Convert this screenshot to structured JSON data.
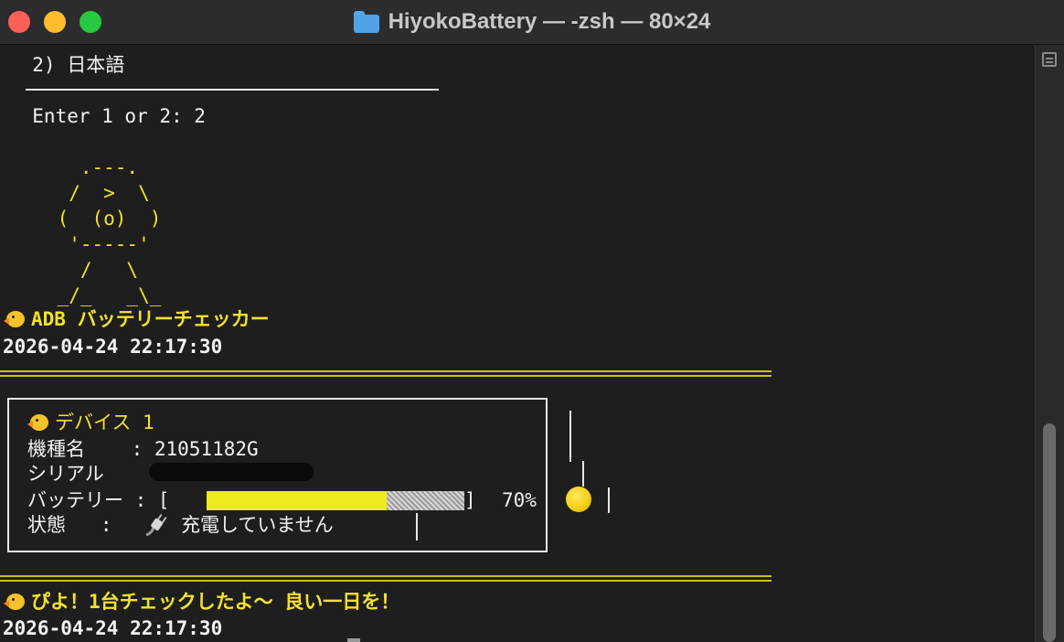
{
  "window": {
    "title": "HiyokoBattery — -zsh — 80×24",
    "folder_icon": "folder-icon"
  },
  "terminal": {
    "menu_option": "  2) 日本語",
    "prompt": "  Enter 1 or 2: 2",
    "ascii_art": [
      "      .---.",
      "     /  >  \\",
      "    (  (o)  )",
      "     '-----'",
      "      /   \\",
      "    _/_   _\\_"
    ],
    "header_title": "ADB バッテリーチェッカー",
    "timestamp_top": "2026-04-24 22:17:30",
    "device": {
      "heading": "デバイス 1",
      "model_label": "機種名    : ",
      "model_value": "21051182G",
      "serial_label": "シリアル",
      "battery_label": "バッテリー : [",
      "battery_close": "]",
      "battery_percent_text": "70%",
      "battery_level": 0.7,
      "status_label": "状態   : ",
      "status_value": "充電していません"
    },
    "footer_message": "ぴよ！1台チェックしたよ～ 良い一日を！",
    "timestamp_bottom": "2026-04-24 22:17:30"
  },
  "colors": {
    "background": "#1e1e1e",
    "text": "#f2f2f2",
    "accent_yellow": "#f3e22a",
    "battery_fill": "#ecec1a",
    "traffic_red": "#fe5f57",
    "traffic_yellow": "#febc2e",
    "traffic_green": "#28c840"
  }
}
